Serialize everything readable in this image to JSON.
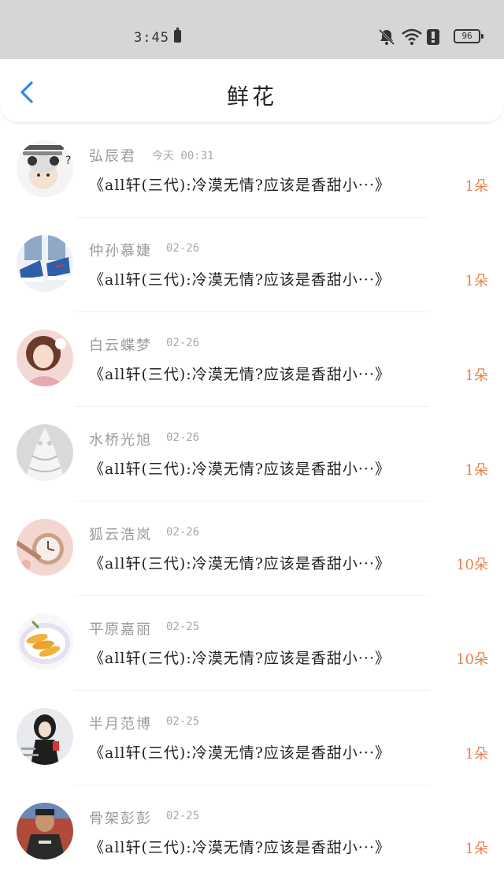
{
  "status_bar": {
    "time": "3:45",
    "battery": "96",
    "icons": [
      "small-battery-icon",
      "bell-off-icon",
      "wifi-icon",
      "alert-icon",
      "battery-icon"
    ]
  },
  "header": {
    "title": "鲜花",
    "back_icon": "chevron-left-icon",
    "accent": "#2a8ee0"
  },
  "colors": {
    "flower_count": "#e8804a",
    "meta_text": "#9a9a9a",
    "status_bar_bg": "#d6d6d6"
  },
  "items": [
    {
      "name": "弘辰君",
      "time": "今天 00:31",
      "article": "《all轩(三代):冷漠无情?应该是香甜小···》",
      "flowers": "1朵",
      "avatar": "avatar-cartoon-girl"
    },
    {
      "name": "仲孙慕婕",
      "time": "02-26",
      "article": "《all轩(三代):冷漠无情?应该是香甜小···》",
      "flowers": "1朵",
      "avatar": "avatar-sneakers"
    },
    {
      "name": "白云蝶梦",
      "time": "02-26",
      "article": "《all轩(三代):冷漠无情?应该是香甜小···》",
      "flowers": "1朵",
      "avatar": "avatar-girl-pink"
    },
    {
      "name": "水桥光旭",
      "time": "02-26",
      "article": "《all轩(三代):冷漠无情?应该是香甜小···》",
      "flowers": "1朵",
      "avatar": "avatar-lace-dress"
    },
    {
      "name": "狐云浩岚",
      "time": "02-26",
      "article": "《all轩(三代):冷漠无情?应该是香甜小···》",
      "flowers": "10朵",
      "avatar": "avatar-watch"
    },
    {
      "name": "平原嘉丽",
      "time": "02-25",
      "article": "《all轩(三代):冷漠无情?应该是香甜小···》",
      "flowers": "10朵",
      "avatar": "avatar-food-plate"
    },
    {
      "name": "半月范博",
      "time": "02-25",
      "article": "《all轩(三代):冷漠无情?应该是香甜小···》",
      "flowers": "1朵",
      "avatar": "avatar-girl-black"
    },
    {
      "name": "骨架彭彭",
      "time": "02-25",
      "article": "《all轩(三代):冷漠无情?应该是香甜小···》",
      "flowers": "1朵",
      "avatar": "avatar-man-portrait"
    }
  ]
}
